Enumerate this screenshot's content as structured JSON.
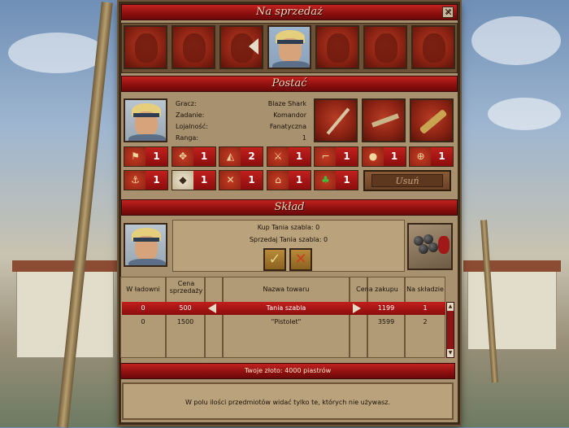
{
  "window": {
    "title": "Na sprzedaż",
    "close_label": "✕"
  },
  "sections": {
    "character": "Postać",
    "storage": "Skład"
  },
  "character": {
    "labels": [
      "Gracz:",
      "Zadanie:",
      "Lojalność:",
      "Ranga:"
    ],
    "values": [
      "Blaze Shark",
      "Komandor",
      "Fanatyczna",
      "1"
    ]
  },
  "skills": [
    {
      "icon": "flag-icon",
      "glyph": "⚑",
      "value": "1"
    },
    {
      "icon": "compass-icon",
      "glyph": "✥",
      "value": "1"
    },
    {
      "icon": "sextant-icon",
      "glyph": "◭",
      "value": "2"
    },
    {
      "icon": "crossed-swords-icon",
      "glyph": "⚔",
      "value": "1"
    },
    {
      "icon": "pistol-icon",
      "glyph": "⌐",
      "value": "1"
    },
    {
      "icon": "cannonballs-icon",
      "glyph": "●",
      "value": "1"
    },
    {
      "icon": "crosshair-icon",
      "glyph": "⊕",
      "value": "1"
    },
    {
      "icon": "grappling-hook-icon",
      "glyph": "⚓",
      "value": "1"
    },
    {
      "icon": "shield-icon",
      "glyph": "◆",
      "value": "1"
    },
    {
      "icon": "tools-icon",
      "glyph": "✕",
      "value": "1"
    },
    {
      "icon": "helmet-icon",
      "glyph": "⌂",
      "value": "1"
    },
    {
      "icon": "clover-icon",
      "glyph": "♣",
      "value": "1"
    }
  ],
  "delete_button": "Usuń",
  "storage": {
    "buy_line": "Kup Tania szabla: 0",
    "sell_line": "Sprzedaj Tania szabla: 0",
    "accept_label": "✓",
    "cancel_label": "✕"
  },
  "table": {
    "headers": {
      "in_hold": "W ładowni",
      "sell_price": "Cena sprzedaży",
      "name": "Nazwa towaru",
      "buy_price": "Cena zakupu",
      "in_stock": "Na składzie"
    },
    "rows": [
      {
        "in_hold": "0",
        "sell_price": "500",
        "name": "Tania szabla",
        "buy_price": "1199",
        "in_stock": "1"
      },
      {
        "in_hold": "0",
        "sell_price": "1500",
        "name": "\"Pistolet\"",
        "buy_price": "3599",
        "in_stock": "2"
      }
    ]
  },
  "gold": "Twoje złoto:  4000  piastrów",
  "message": "W polu ilości przedmiotów widać tylko te, których nie używasz."
}
